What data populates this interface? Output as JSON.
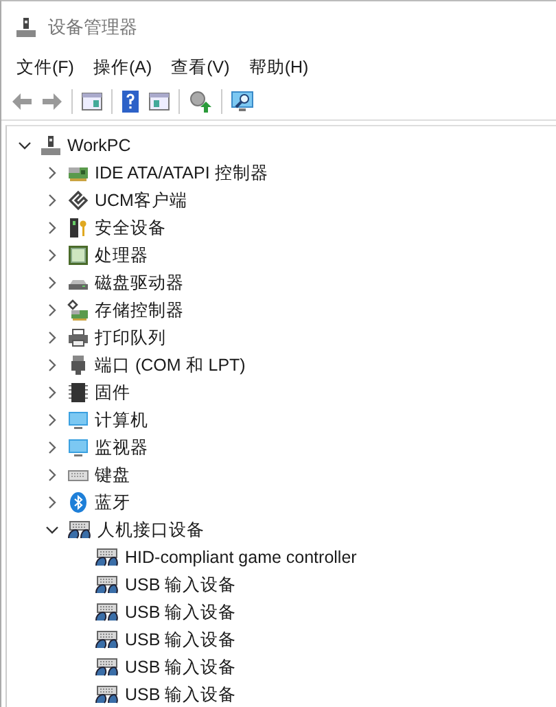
{
  "window": {
    "title": "设备管理器"
  },
  "menu": [
    "文件(F)",
    "操作(A)",
    "查看(V)",
    "帮助(H)"
  ],
  "toolbar": [
    {
      "kind": "back"
    },
    {
      "kind": "forward"
    },
    {
      "kind": "sep"
    },
    {
      "kind": "tree"
    },
    {
      "kind": "sep"
    },
    {
      "kind": "help"
    },
    {
      "kind": "pane"
    },
    {
      "kind": "sep"
    },
    {
      "kind": "update"
    },
    {
      "kind": "sep"
    },
    {
      "kind": "scan"
    }
  ],
  "tree": {
    "label": "WorkPC",
    "kind": "computer",
    "expanded": true,
    "children": [
      {
        "label": "IDE ATA/ATAPI 控制器",
        "kind": "ide",
        "expanded": false
      },
      {
        "label": "UCM客户端",
        "kind": "ucm",
        "expanded": false
      },
      {
        "label": "安全设备",
        "kind": "security",
        "expanded": false
      },
      {
        "label": "处理器",
        "kind": "cpu",
        "expanded": false
      },
      {
        "label": "磁盘驱动器",
        "kind": "disk",
        "expanded": false
      },
      {
        "label": "存储控制器",
        "kind": "storage",
        "expanded": false
      },
      {
        "label": "打印队列",
        "kind": "printer",
        "expanded": false
      },
      {
        "label": "端口 (COM 和 LPT)",
        "kind": "port",
        "expanded": false
      },
      {
        "label": "固件",
        "kind": "chip",
        "expanded": false
      },
      {
        "label": "计算机",
        "kind": "monitor",
        "expanded": false
      },
      {
        "label": "监视器",
        "kind": "monitor",
        "expanded": false
      },
      {
        "label": "键盘",
        "kind": "keyboard",
        "expanded": false
      },
      {
        "label": "蓝牙",
        "kind": "bluetooth",
        "expanded": false
      },
      {
        "label": "人机接口设备",
        "kind": "hid",
        "expanded": true,
        "children": [
          {
            "label": "HID-compliant game controller",
            "kind": "hid"
          },
          {
            "label": "USB 输入设备",
            "kind": "hid"
          },
          {
            "label": "USB 输入设备",
            "kind": "hid"
          },
          {
            "label": "USB 输入设备",
            "kind": "hid"
          },
          {
            "label": "USB 输入设备",
            "kind": "hid"
          },
          {
            "label": "USB 输入设备",
            "kind": "hid"
          }
        ]
      }
    ]
  }
}
